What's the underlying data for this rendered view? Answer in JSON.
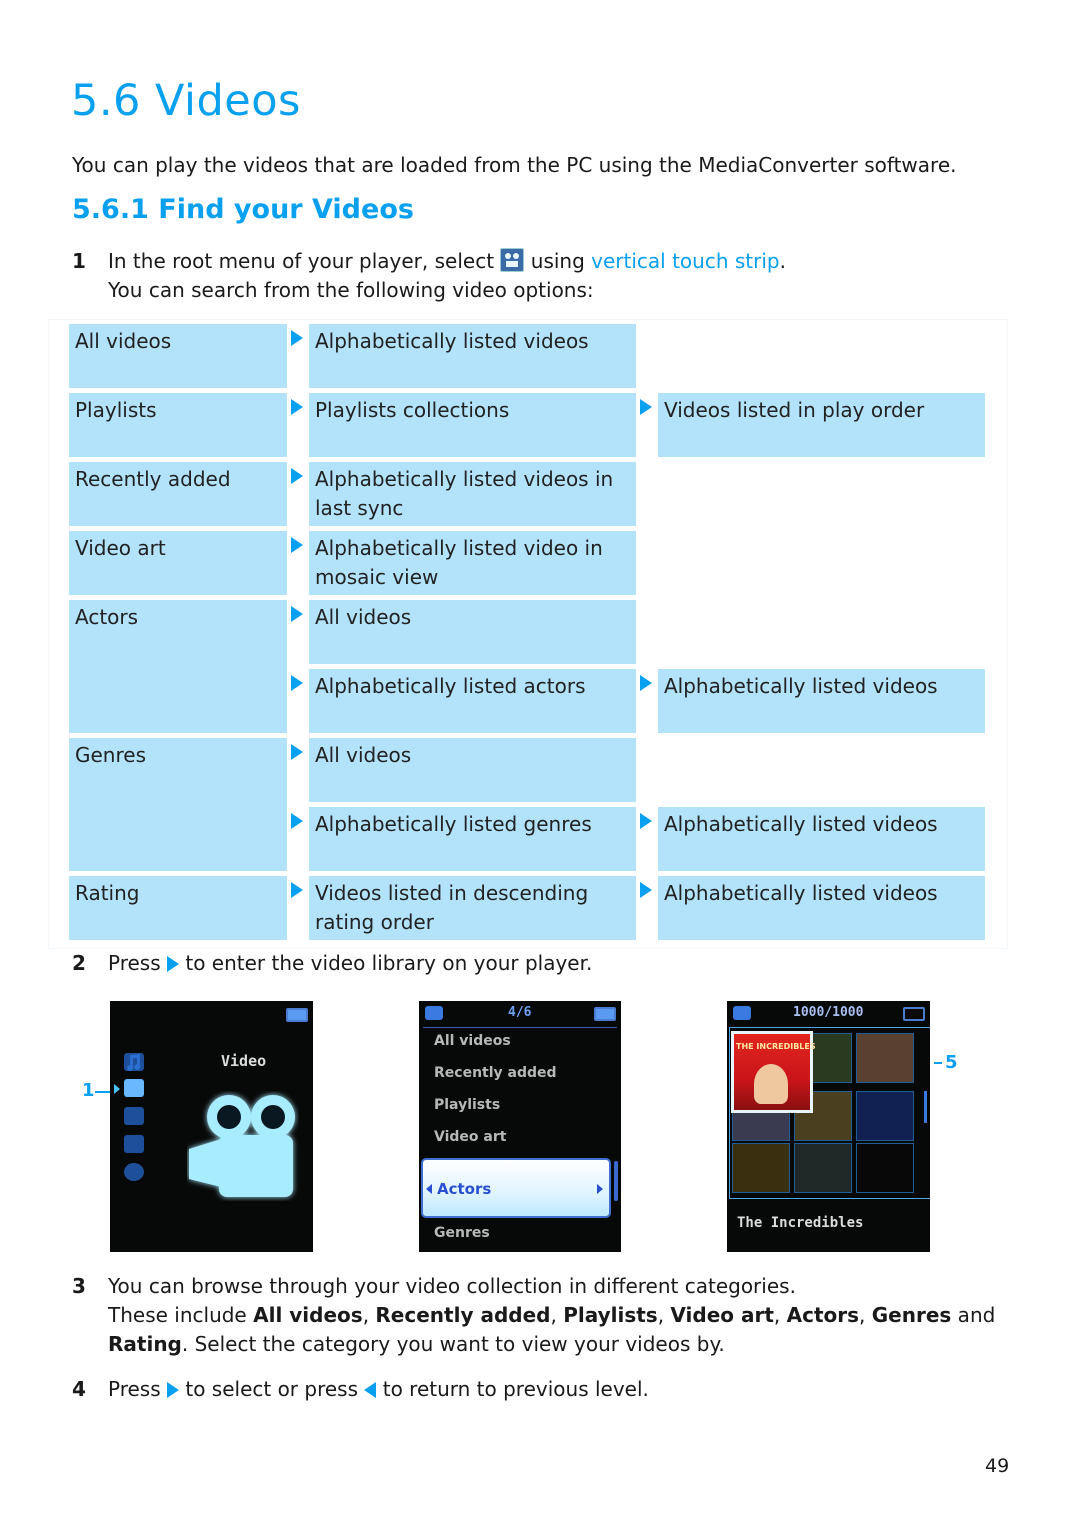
{
  "page": {
    "section_title": "5.6  Videos",
    "intro": "You can play the videos that are loaded from the PC using the MediaConverter software.",
    "subsection_title": "5.6.1 Find your Videos",
    "page_number": "49"
  },
  "steps": {
    "s1": {
      "num": "1",
      "pre": "In the root menu of your player, select ",
      "icon": "video-camera-icon",
      "mid": " using ",
      "link": "vertical touch strip",
      "post": ".",
      "line2": "You can search from the following video options:"
    },
    "s2": {
      "num": "2",
      "pre": "Press ",
      "icon": "right-arrow-icon",
      "post": " to enter the video library on your player."
    },
    "s3": {
      "num": "3",
      "line1": "You can browse through your video collection in different categories.",
      "line2_pre": "These include ",
      "bold_items": [
        "All videos",
        "Recently added",
        "Playlists",
        "Video art",
        "Actors",
        "Genres",
        "Rating"
      ],
      "sep": ", ",
      "and": " and",
      "line3_post": ". Select the category you want to view your videos by."
    },
    "s4": {
      "num": "4",
      "pre": "Press ",
      "mid": " to select or press ",
      "post": " to return to previous level."
    }
  },
  "table": {
    "rows": [
      {
        "c1": "All videos",
        "c2": "Alphabetically listed videos",
        "c3": null
      },
      {
        "c1": "Playlists",
        "c2": "Playlists collections",
        "c3": "Videos listed in play order"
      },
      {
        "c1": "Recently added",
        "c2": "Alphabetically listed videos in last sync",
        "c3": null
      },
      {
        "c1": "Video art",
        "c2": "Alphabetically listed video in mosaic view",
        "c3": null
      },
      {
        "c1": "Actors",
        "c2": "All videos",
        "c3": null
      },
      {
        "c1": "",
        "c2": "Alphabetically listed actors",
        "c3": "Alphabetically listed videos"
      },
      {
        "c1": "Genres",
        "c2": "All videos",
        "c3": null
      },
      {
        "c1": "",
        "c2": "Alphabetically listed genres",
        "c3": "Alphabetically listed videos"
      },
      {
        "c1": "Rating",
        "c2": "Videos listed in descending rating order",
        "c3": "Alphabetically listed videos"
      }
    ]
  },
  "screens": {
    "home": {
      "title": "Video",
      "callout": "1",
      "sidebar_icons": [
        "music-icon",
        "video-icon",
        "camera-icon",
        "radio-icon",
        "settings-icon"
      ],
      "selected_icon": "video-icon"
    },
    "menu": {
      "counter": "4/6",
      "items": [
        "All videos",
        "Recently added",
        "Playlists",
        "Video art",
        "Actors",
        "Genres"
      ],
      "selected": "Actors"
    },
    "mosaic": {
      "counter": "1000/1000",
      "selected_title": "The Incredibles",
      "cover_text": "THE INCREDIBLES",
      "callout": "5"
    }
  },
  "colors": {
    "accent": "#0aa0f0",
    "cell_bg": "#b3e3fb",
    "screen_bg": "#070808"
  }
}
